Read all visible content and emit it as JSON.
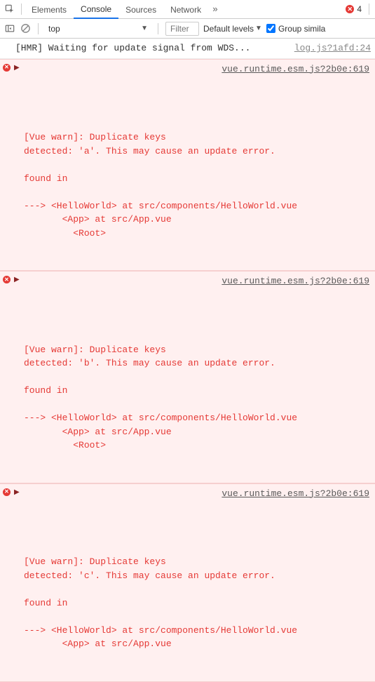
{
  "tabs": {
    "items": [
      "Elements",
      "Console",
      "Sources",
      "Network"
    ],
    "active": "Console",
    "error_count": "4"
  },
  "toolbar": {
    "context": "top",
    "filter_placeholder": "Filter",
    "levels_label": "Default levels",
    "group_label": "Group simila"
  },
  "log": {
    "info": {
      "text": "[HMR] Waiting for update signal from WDS...",
      "src": "log.js?1afd:24"
    },
    "errors": [
      {
        "src": "vue.runtime.esm.js?2b0e:619",
        "body": "[Vue warn]: Duplicate keys\ndetected: 'a'. This may cause an update error.\n\nfound in\n\n---> <HelloWorld> at src/components/HelloWorld.vue\n       <App> at src/App.vue\n         <Root>"
      },
      {
        "src": "vue.runtime.esm.js?2b0e:619",
        "body": "[Vue warn]: Duplicate keys\ndetected: 'b'. This may cause an update error.\n\nfound in\n\n---> <HelloWorld> at src/components/HelloWorld.vue\n       <App> at src/App.vue\n         <Root>"
      },
      {
        "src": "vue.runtime.esm.js?2b0e:619",
        "body": "[Vue warn]: Duplicate keys\ndetected: 'c'. This may cause an update error.\n\nfound in\n\n---> <HelloWorld> at src/components/HelloWorld.vue\n       <App> at src/App.vue"
      }
    ]
  }
}
